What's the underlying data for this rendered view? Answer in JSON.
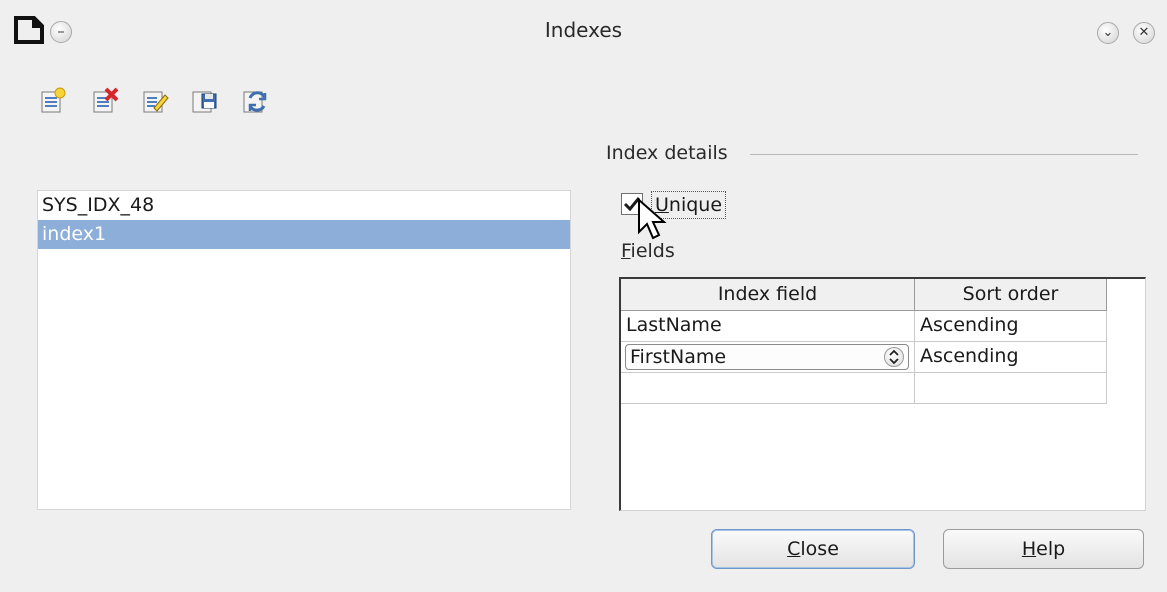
{
  "window": {
    "title": "Indexes",
    "controls": {
      "minimize_glyph": "⌄",
      "close_glyph": "✕"
    }
  },
  "toolbar": {
    "icons": [
      "new-index-icon",
      "delete-index-icon",
      "rename-index-icon",
      "save-index-icon",
      "reset-index-icon"
    ]
  },
  "index_list": {
    "items": [
      "SYS_IDX_48",
      "index1"
    ],
    "selected": "index1"
  },
  "details": {
    "group_label": "Index details",
    "unique": {
      "label_first": "U",
      "label_rest": "nique",
      "checked": true
    },
    "fields_label_first": "F",
    "fields_label_rest": "ields",
    "grid": {
      "headers": [
        "Index field",
        "Sort order"
      ],
      "rows": [
        {
          "field": "LastName",
          "order": "Ascending"
        },
        {
          "field": "FirstName",
          "order": "Ascending"
        },
        {
          "field": "",
          "order": ""
        }
      ]
    }
  },
  "buttons": {
    "close_first": "C",
    "close_rest": "lose",
    "help_first": "H",
    "help_rest": "elp"
  },
  "colors": {
    "selection": "#8caed9",
    "background": "#efefef"
  }
}
